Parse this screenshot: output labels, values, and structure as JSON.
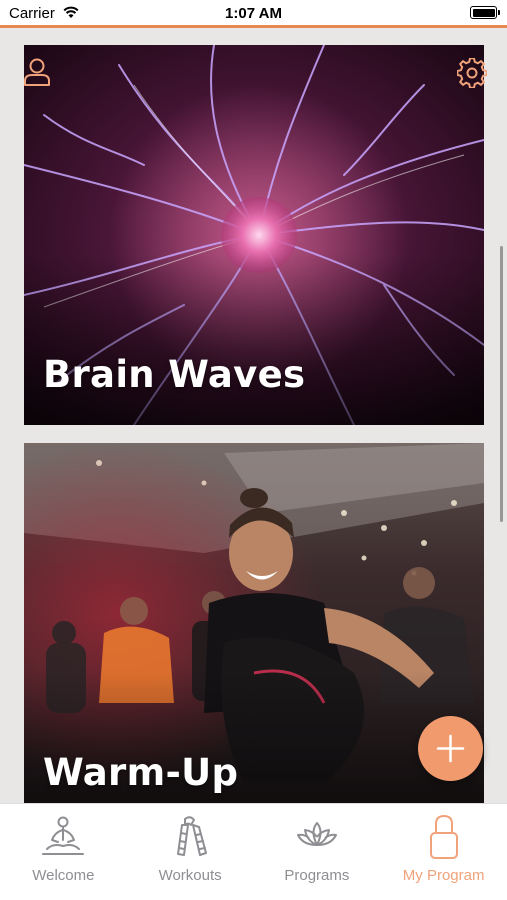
{
  "status_bar": {
    "carrier": "Carrier",
    "time": "1:07 AM"
  },
  "colors": {
    "accent": "#e8874f",
    "fab": "#f09a6d",
    "tab_active": "#f0a27a",
    "tab_inactive": "#8e8e93"
  },
  "cards": [
    {
      "title": "Brain Waves",
      "image": "plasma-ball-image"
    },
    {
      "title": "Warm-Up",
      "image": "group-fitness-class-image"
    }
  ],
  "header_icons": {
    "profile": "user-icon",
    "settings": "gear-icon"
  },
  "fab": {
    "icon": "plus-icon"
  },
  "tabs": [
    {
      "label": "Welcome",
      "icon": "meditation-icon",
      "active": false
    },
    {
      "label": "Workouts",
      "icon": "hand-gripper-icon",
      "active": false
    },
    {
      "label": "Programs",
      "icon": "lotus-icon",
      "active": false
    },
    {
      "label": "My Program",
      "icon": "padlock-icon",
      "active": true
    }
  ]
}
